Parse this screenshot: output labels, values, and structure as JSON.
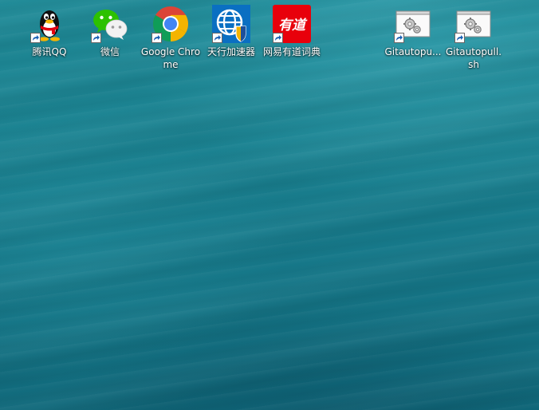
{
  "desktop": {
    "icons": [
      {
        "label": "腾讯QQ",
        "icon": "qq-penguin-icon"
      },
      {
        "label": "微信",
        "icon": "wechat-icon"
      },
      {
        "label": "Google Chrome",
        "icon": "chrome-icon"
      },
      {
        "label": "天行加速器",
        "icon": "globe-shield-icon"
      },
      {
        "label": "网易有道词典",
        "icon": "youdao-dict-icon"
      },
      {
        "label": "Gitautopu...",
        "icon": "script-gears-icon"
      },
      {
        "label": "Gitautopull.sh",
        "icon": "script-gears-icon"
      }
    ],
    "youdao_badge_text": "有道",
    "colors": {
      "wallpaper": "#1a8190",
      "chrome_red": "#db4437",
      "chrome_green": "#0f9d58",
      "chrome_yellow": "#f4b400",
      "chrome_blue": "#4285f4",
      "wechat_green": "#2dc100",
      "youdao_red": "#e8000b",
      "accelerator_blue": "#0a6fc2"
    }
  }
}
